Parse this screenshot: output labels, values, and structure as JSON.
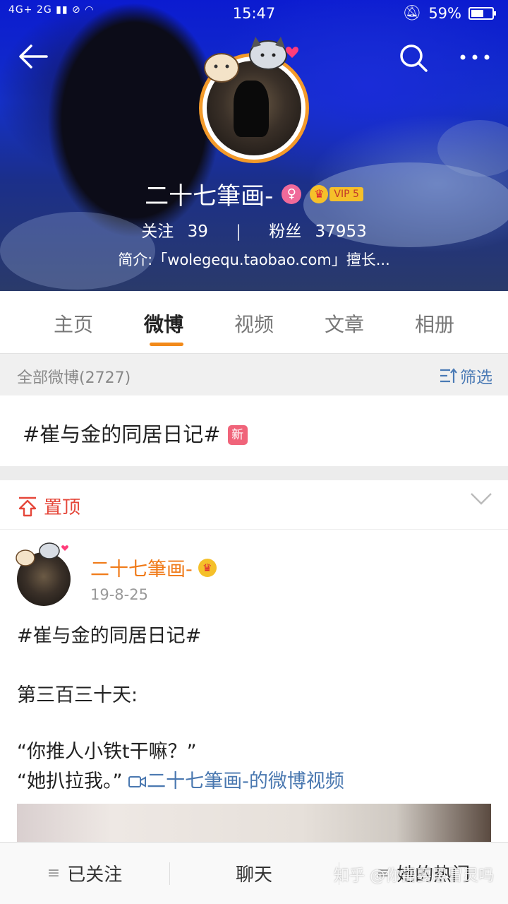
{
  "status_bar": {
    "network": "4G+ 2G",
    "time": "15:47",
    "battery_text": "59%",
    "battery_level": 0.59
  },
  "profile": {
    "name": "二十七筆画-",
    "gender_icon": "female-icon",
    "vip_label": "VIP 5",
    "following_label": "关注",
    "following_count": "39",
    "divider": "|",
    "fans_label": "粉丝",
    "fans_count": "37953",
    "bio": "简介:「wolegequ.taobao.com」擅长..."
  },
  "tabs": [
    {
      "label": "主页",
      "active": false
    },
    {
      "label": "微博",
      "active": true
    },
    {
      "label": "视频",
      "active": false
    },
    {
      "label": "文章",
      "active": false
    },
    {
      "label": "相册",
      "active": false
    }
  ],
  "filter": {
    "all_posts_label": "全部微博(2727)",
    "filter_label": "筛选"
  },
  "topic_bar": {
    "text": "#崔与金的同居日记#",
    "badge": "新"
  },
  "pinned": {
    "label": "置顶"
  },
  "post": {
    "author": "二十七筆画-",
    "date": "19-8-25",
    "hashtag": "#崔与金的同居日记#",
    "line1": "第三百三十天:",
    "line2": "“你推人小铁t干嘛？”",
    "line3": "“她扒拉我。”",
    "video_link": "二十七筆画-的微博视频"
  },
  "bottom_bar": {
    "follow": "已关注",
    "chat": "聊天",
    "hot": "她的热门"
  },
  "watermark": "知乎 @你需要恩冒灵吗",
  "colors": {
    "accent_orange": "#f28a1a",
    "link_blue": "#4a78b0",
    "pin_red": "#e5473a"
  }
}
